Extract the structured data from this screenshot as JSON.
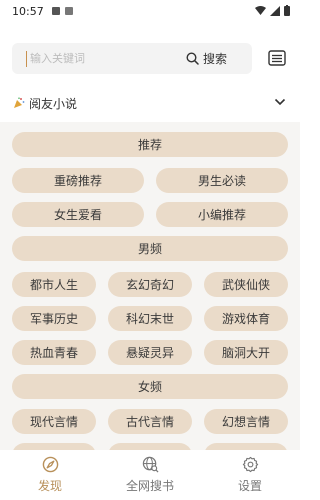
{
  "status_bar": {
    "time": "10:57"
  },
  "search": {
    "placeholder": "输入关键词",
    "button_label": "搜索"
  },
  "source": {
    "name": "阅友小说"
  },
  "categories": {
    "sections": [
      {
        "header": "推荐",
        "items": [
          "重磅推荐",
          "男生必读",
          "女生爱看",
          "小编推荐"
        ]
      },
      {
        "header": "男频",
        "items": [
          "都市人生",
          "玄幻奇幻",
          "武侠仙侠",
          "军事历史",
          "科幻末世",
          "游戏体育",
          "热血青春",
          "悬疑灵异",
          "脑洞大开"
        ]
      },
      {
        "header": "女频",
        "items": [
          "现代言情",
          "古代言情",
          "幻想言情"
        ]
      }
    ]
  },
  "bottom_nav": {
    "items": [
      {
        "label": "发现",
        "icon": "compass-icon",
        "active": true
      },
      {
        "label": "全网搜书",
        "icon": "globe-search-icon",
        "active": false
      },
      {
        "label": "设置",
        "icon": "gear-icon",
        "active": false
      }
    ]
  },
  "colors": {
    "accent": "#b8905a",
    "pill_bg": "#eadbc9",
    "panel_bg": "#f6f5f3"
  }
}
